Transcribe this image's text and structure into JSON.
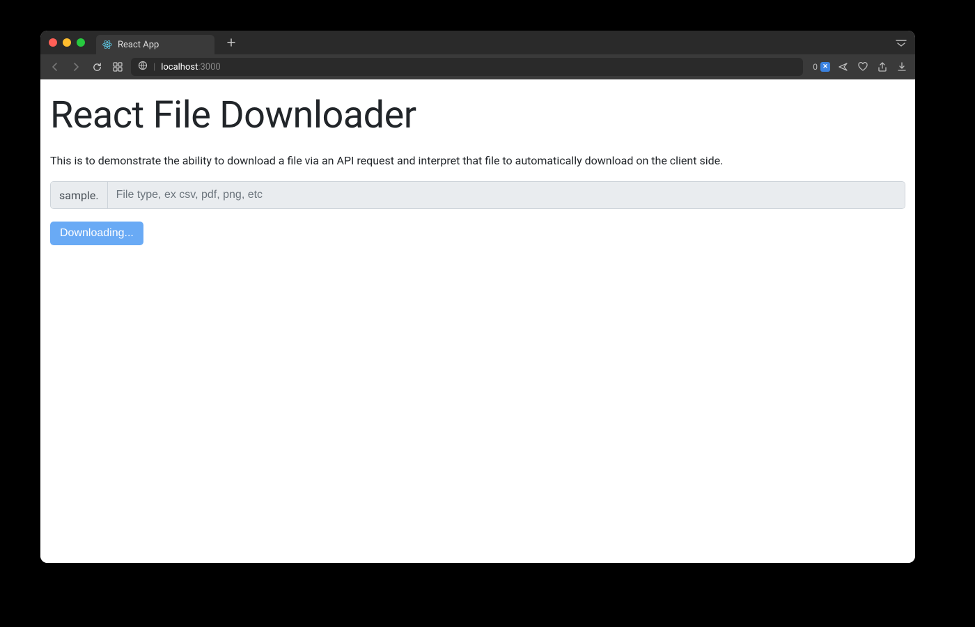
{
  "browser": {
    "tab": {
      "title": "React App"
    },
    "url": {
      "host": "localhost",
      "port": ":3000"
    },
    "badge_count": "0"
  },
  "page": {
    "title": "React File Downloader",
    "description": "This is to demonstrate the ability to download a file via an API request and interpret that file to automatically download on the client side.",
    "input": {
      "prefix": "sample.",
      "placeholder": "File type, ex csv, pdf, png, etc",
      "value": ""
    },
    "button": {
      "label": "Downloading..."
    }
  }
}
